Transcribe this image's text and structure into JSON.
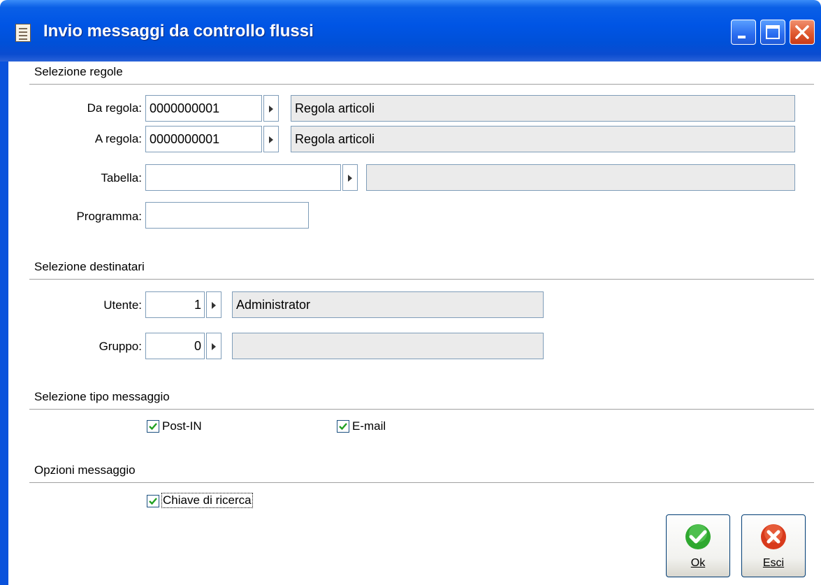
{
  "window": {
    "title": "Invio messaggi da controllo flussi",
    "icon": "document-icon",
    "controls": [
      "minimize-icon",
      "maximize-icon",
      "close-icon"
    ]
  },
  "sections": {
    "regole": "Selezione regole",
    "destinatari": "Selezione destinatari",
    "tipo_messaggio": "Selezione tipo messaggio",
    "opzioni": "Opzioni messaggio"
  },
  "fields": {
    "da_regola": {
      "label": "Da regola:",
      "code": "0000000001",
      "description": "Regola articoli"
    },
    "a_regola": {
      "label": "A regola:",
      "code": "0000000001",
      "description": "Regola articoli"
    },
    "tabella": {
      "label": "Tabella:",
      "code": "",
      "description": ""
    },
    "programma": {
      "label": "Programma:",
      "value": ""
    },
    "utente": {
      "label": "Utente:",
      "code": "1",
      "description": "Administrator"
    },
    "gruppo": {
      "label": "Gruppo:",
      "code": "0",
      "description": ""
    }
  },
  "checkboxes": {
    "post_in": {
      "label": "Post-IN",
      "checked": true
    },
    "email": {
      "label": "E-mail",
      "checked": true
    },
    "chiave": {
      "label": "Chiave di ricerca",
      "checked": true
    }
  },
  "buttons": {
    "ok": {
      "label": "Ok",
      "icon": "check-icon",
      "color": "#2fa82f"
    },
    "esci": {
      "label": "Esci",
      "icon": "cancel-icon",
      "color": "#d83a1c"
    }
  },
  "colors": {
    "titlebar": "#0055e5",
    "field_border": "#7f9db9",
    "readonly_bg": "#ebebeb"
  }
}
